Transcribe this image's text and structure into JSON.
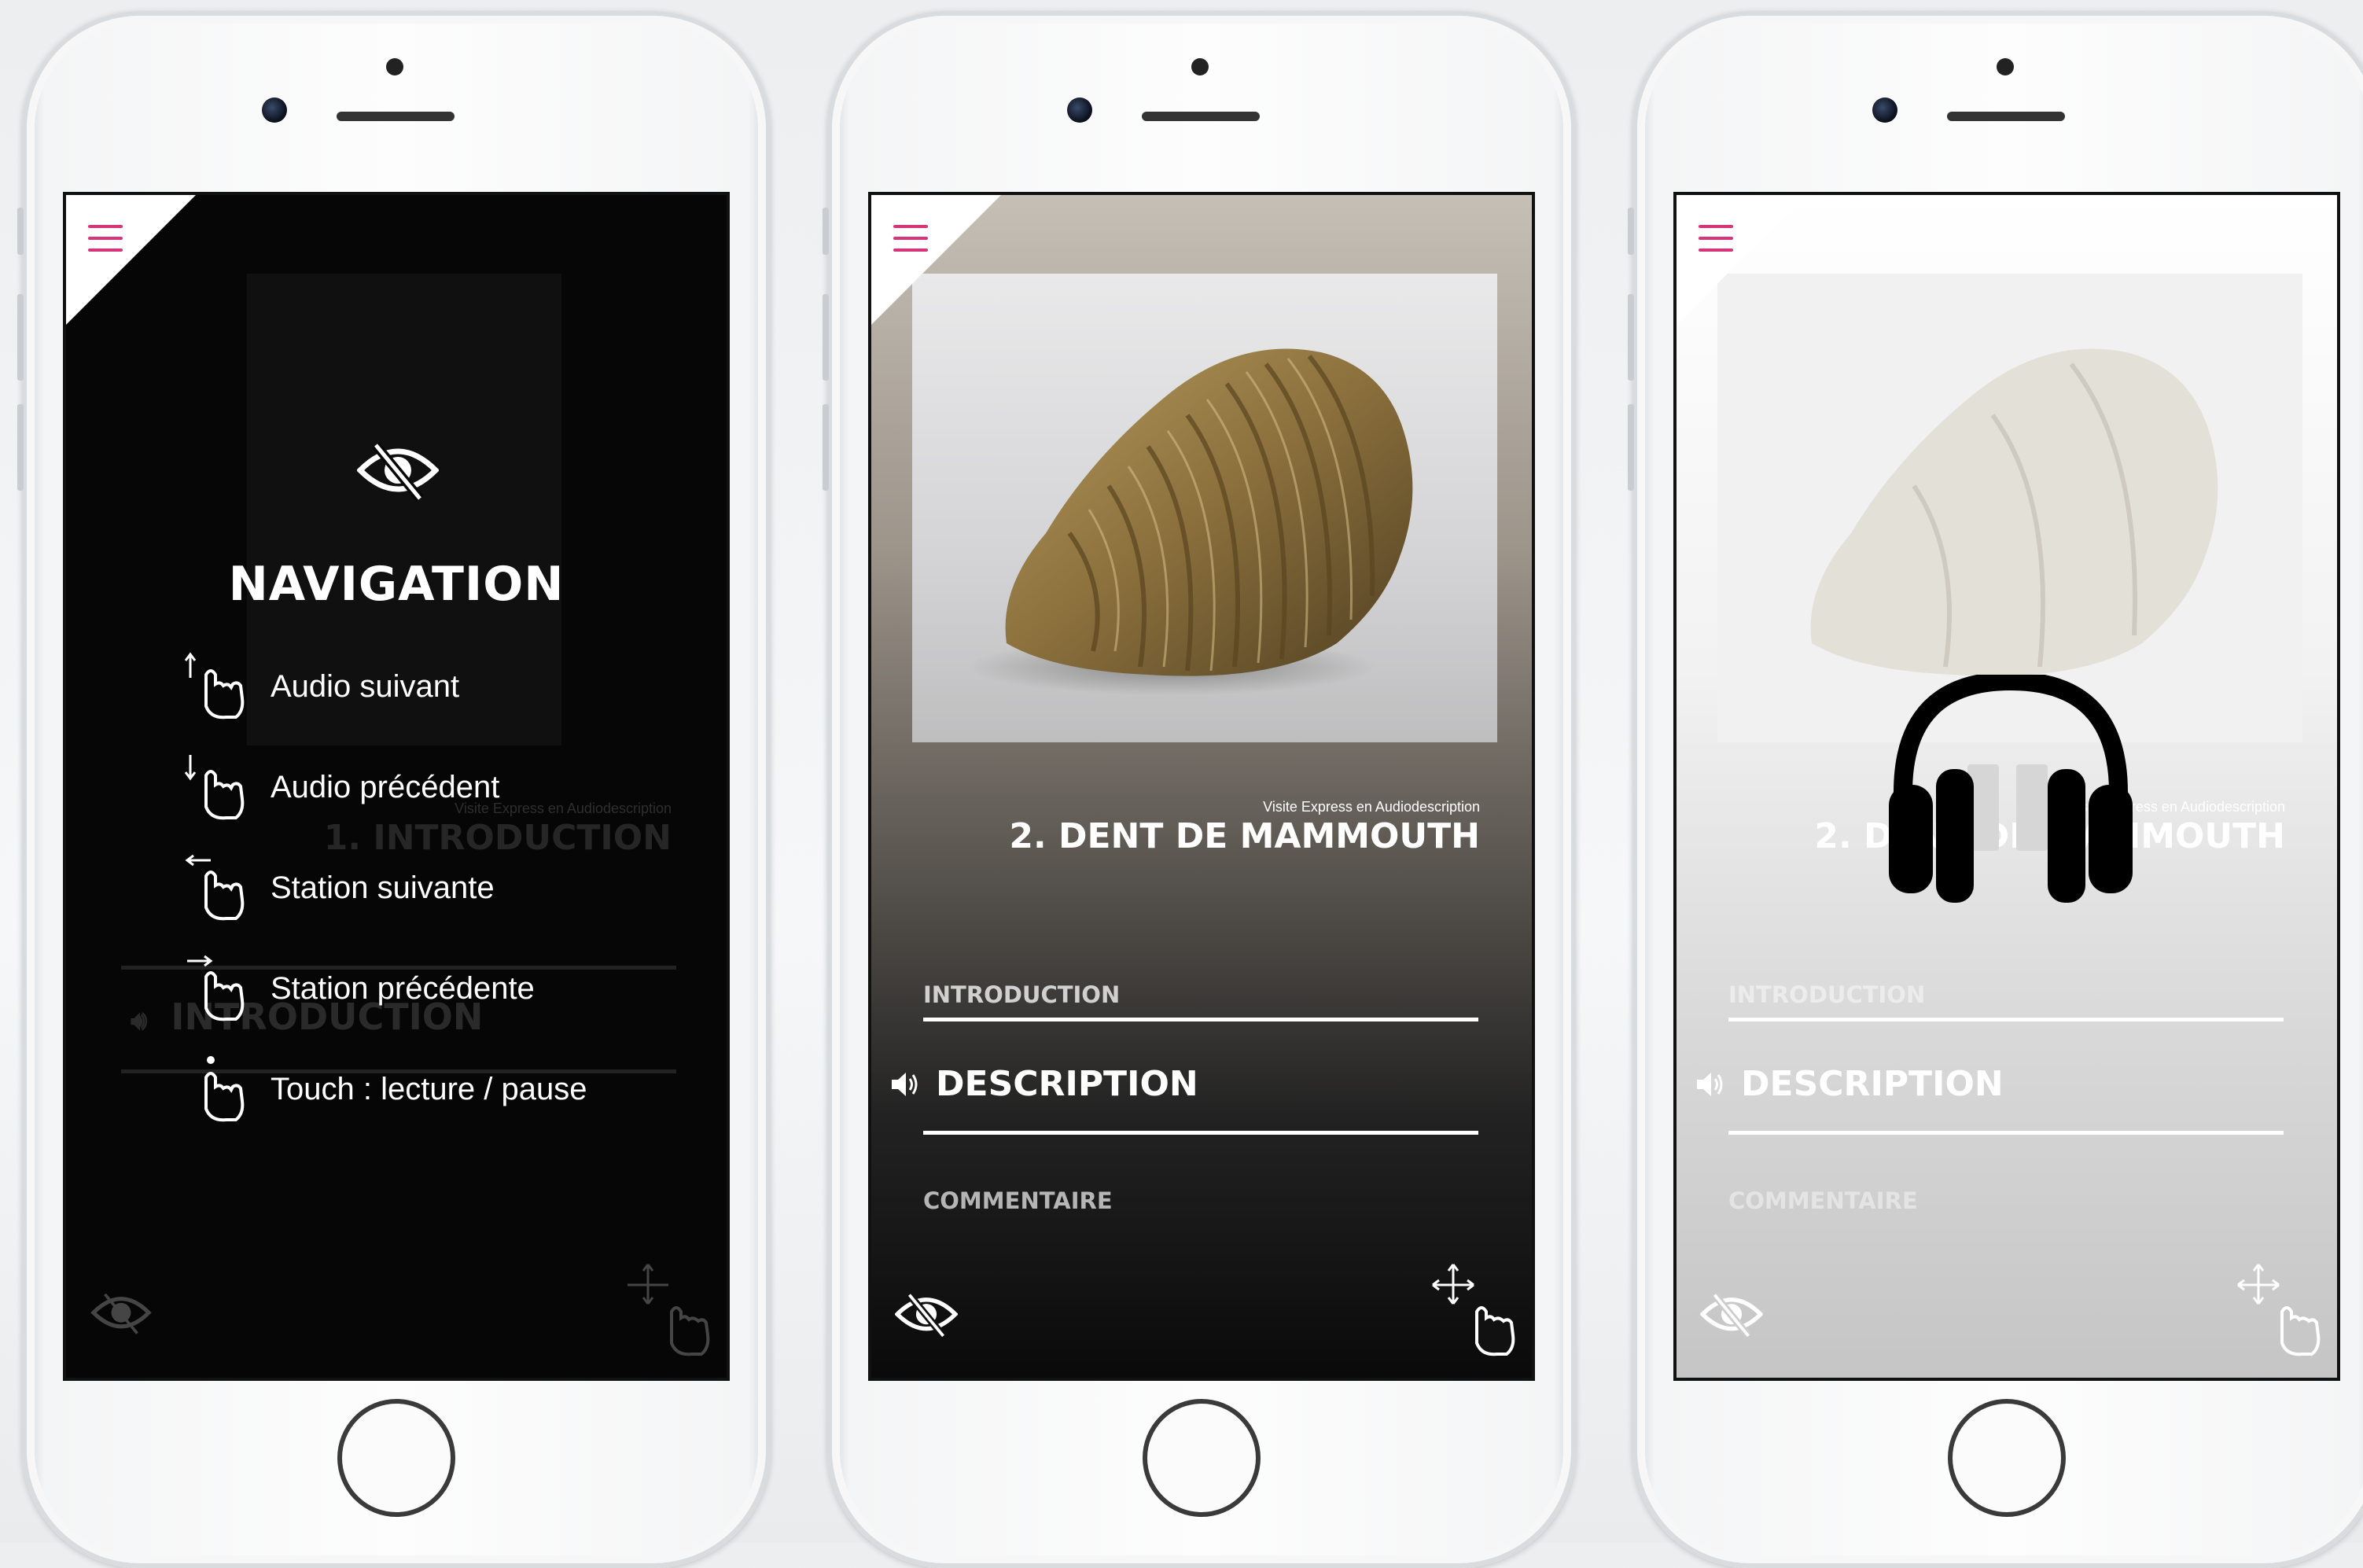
{
  "colors": {
    "accent": "#d6357a",
    "navbg": "#060606"
  },
  "phones": [
    {
      "navigation": {
        "title": "NAVIGATION",
        "items": [
          {
            "label": "Audio suivant",
            "icon": "swipe-up-hand-icon"
          },
          {
            "label": "Audio précédent",
            "icon": "swipe-down-hand-icon"
          },
          {
            "label": "Station suivante",
            "icon": "swipe-left-hand-icon"
          },
          {
            "label": "Station précédente",
            "icon": "swipe-right-hand-icon"
          },
          {
            "label": "Touch : lecture / pause",
            "icon": "tap-hand-icon"
          }
        ]
      },
      "background": {
        "subtitle": "Visite Express en Audiodescription",
        "title": "1. INTRODUCTION",
        "track": "INTRODUCTION"
      }
    },
    {
      "subtitle": "Visite Express en Audiodescription",
      "title": "2. DENT DE MAMMOUTH",
      "tracks": [
        {
          "label": "INTRODUCTION",
          "active": false
        },
        {
          "label": "DESCRIPTION",
          "active": true
        },
        {
          "label": "COMMENTAIRE",
          "active": false
        }
      ]
    },
    {
      "subtitle": "Visite Express en Audiodescription",
      "title": "2. DENT DE MAMMOUTH",
      "tracks": [
        {
          "label": "INTRODUCTION",
          "active": false
        },
        {
          "label": "DESCRIPTION",
          "active": true
        },
        {
          "label": "COMMENTAIRE",
          "active": false
        }
      ],
      "overlay_icon": "headphones-icon"
    }
  ]
}
